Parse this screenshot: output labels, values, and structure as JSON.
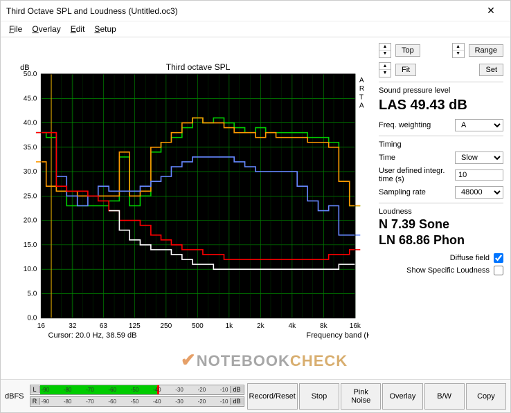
{
  "window": {
    "title": "Third Octave SPL and Loudness (Untitled.oc3)"
  },
  "menu": {
    "file": "File",
    "overlay": "Overlay",
    "edit": "Edit",
    "setup": "Setup"
  },
  "side": {
    "top": "Top",
    "fit": "Fit",
    "range": "Range",
    "set": "Set",
    "spl_label": "Sound pressure level",
    "spl_value": "LAS 49.43 dB",
    "freq_weight_label": "Freq. weighting",
    "freq_weight_value": "A",
    "timing_label": "Timing",
    "time_label": "Time",
    "time_value": "Slow",
    "integr_label": "User defined integr. time (s)",
    "integr_value": "10",
    "sampling_label": "Sampling rate",
    "sampling_value": "48000",
    "loudness_label": "Loudness",
    "loudness_n": "N 7.39 Sone",
    "loudness_ln": "LN 68.86 Phon",
    "diffuse_label": "Diffuse field",
    "show_specific_label": "Show Specific Loudness"
  },
  "bottom": {
    "dbfs": "dBFS",
    "L": "L",
    "R": "R",
    "dB": "dB",
    "ticks": [
      "-90",
      "-80",
      "-70",
      "-60",
      "-50",
      "-40",
      "-30",
      "-20",
      "-10"
    ],
    "record": "Record/Reset",
    "stop": "Stop",
    "pink": "Pink Noise",
    "overlay": "Overlay",
    "bw": "B/W",
    "copy": "Copy"
  },
  "chart": {
    "title": "Third octave SPL",
    "ylabel": "dB",
    "xlabel": "Frequency band (Hz)",
    "cursor": "Cursor:   20.0 Hz, 38.59 dB",
    "arta": "A R T A"
  },
  "watermark": {
    "a": "NOTEBOOK",
    "b": "CHECK"
  },
  "chart_data": {
    "type": "line",
    "xlabel": "Frequency band (Hz)",
    "ylabel": "dB",
    "title": "Third octave SPL",
    "ylim": [
      0,
      50
    ],
    "xticks": [
      16,
      32,
      63,
      125,
      250,
      500,
      1000,
      2000,
      4000,
      8000,
      16000
    ],
    "xtick_labels": [
      "16",
      "32",
      "63",
      "125",
      "250",
      "500",
      "1k",
      "2k",
      "4k",
      "8k",
      "16k"
    ],
    "x": [
      16,
      20,
      25,
      31.5,
      40,
      50,
      63,
      80,
      100,
      125,
      160,
      200,
      250,
      315,
      400,
      500,
      630,
      800,
      1000,
      1250,
      1600,
      2000,
      2500,
      3150,
      4000,
      5000,
      6300,
      8000,
      10000,
      12500,
      16000
    ],
    "series": [
      {
        "name": "green",
        "color": "#00cc00",
        "values": [
          38,
          37,
          26,
          23,
          23,
          23,
          23,
          24,
          33,
          23,
          25,
          34,
          36,
          37,
          39,
          41,
          40,
          41,
          40,
          39,
          38,
          39,
          38,
          38,
          38,
          38,
          37,
          37,
          36,
          28,
          23
        ]
      },
      {
        "name": "orange",
        "color": "#ff9900",
        "values": [
          32,
          27,
          26,
          26,
          25,
          25,
          25,
          25,
          34,
          25,
          26,
          35,
          36,
          38,
          40,
          41,
          40,
          40,
          39,
          38,
          38,
          37,
          38,
          37,
          37,
          37,
          36,
          36,
          35,
          28,
          23
        ]
      },
      {
        "name": "blue",
        "color": "#6688ff",
        "values": [
          38,
          38,
          29,
          25,
          23,
          25,
          27,
          26,
          26,
          26,
          27,
          28,
          29,
          31,
          32,
          33,
          33,
          33,
          33,
          32,
          31,
          30,
          30,
          30,
          30,
          27,
          24,
          22,
          23,
          17,
          17
        ]
      },
      {
        "name": "red",
        "color": "#ff0000",
        "values": [
          38,
          38,
          27,
          26,
          26,
          25,
          24,
          22,
          20,
          20,
          19,
          17,
          16,
          15,
          14,
          14,
          13,
          13,
          12,
          12,
          12,
          12,
          12,
          12,
          12,
          12,
          12,
          12,
          13,
          13,
          14
        ]
      },
      {
        "name": "white",
        "color": "#ffffff",
        "values": [
          null,
          null,
          null,
          null,
          null,
          null,
          null,
          22,
          18,
          16,
          15,
          14,
          14,
          13,
          12,
          11,
          11,
          10,
          10,
          10,
          10,
          10,
          10,
          10,
          10,
          10,
          10,
          10,
          10,
          11,
          11
        ]
      }
    ],
    "cursor": {
      "x": 20,
      "y": 38.59
    }
  }
}
